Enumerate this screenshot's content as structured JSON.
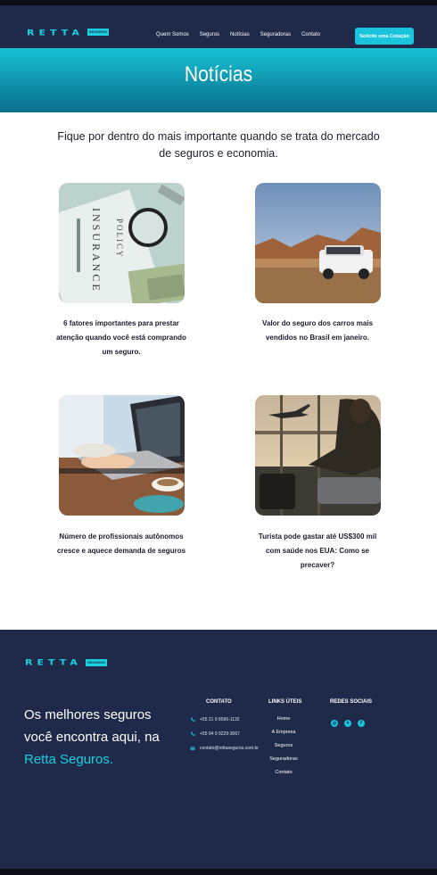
{
  "brand": {
    "logo_text": "RETTA",
    "logo_tag": "SEGUROS"
  },
  "nav": {
    "items": [
      "Quem Somos",
      "Seguros",
      "Notícias",
      "Seguradoras",
      "Contato"
    ],
    "cta_label": "Solicite uma Cotação"
  },
  "hero": {
    "title": "Notícias"
  },
  "intro": {
    "text": "Fique por dentro do mais importante quando se trata do mercado de seguros e economia."
  },
  "articles": [
    {
      "caption": "6 fatores importantes para prestar atenção quando você está comprando um seguro.",
      "image": "insurance-policy-photo"
    },
    {
      "caption": "Valor do seguro dos carros mais vendidos no Brasil em janeiro.",
      "image": "white-suv-desert-photo"
    },
    {
      "caption": "Número de profissionais autônomos cresce e aquece demanda de seguros",
      "image": "laptop-coffee-photo"
    },
    {
      "caption": "Turista pode gastar até US$300 mil com saúde nos EUA: Como se precaver?",
      "image": "airport-traveler-photo"
    }
  ],
  "footer": {
    "logo_text": "RETTA",
    "logo_tag": "SEGUROS",
    "slogan_line1": "Os melhores seguros",
    "slogan_line2": "você encontra aqui, na",
    "slogan_brand": "Retta Seguros.",
    "contact_heading": "CONTATO",
    "contacts": [
      {
        "icon": "phone-icon",
        "text": "+55 21 9 8596-1132"
      },
      {
        "icon": "phone-icon",
        "text": "+55 94 9 9229-3067"
      },
      {
        "icon": "mail-icon",
        "text": "contato@rettaseguros.com.br"
      }
    ],
    "links_heading": "LINKS ÚTEIS",
    "links": [
      "Home",
      "A Empresa",
      "Seguros",
      "Seguradoras",
      "Contato"
    ],
    "social_heading": "REDES SOCIAIS",
    "social": [
      "instagram-icon",
      "twitter-icon",
      "facebook-icon"
    ]
  }
}
